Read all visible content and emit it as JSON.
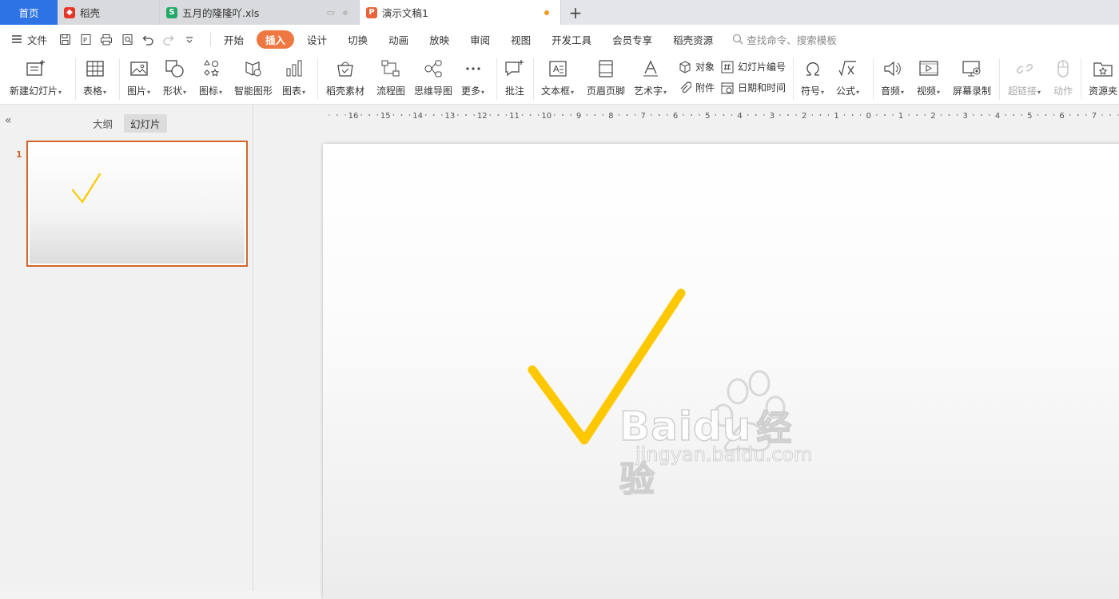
{
  "tabs": {
    "home": "首页",
    "tab1": "稻壳",
    "tab2": "五月的隆隆吖.xls",
    "tab3": "演示文稿1",
    "add": "+"
  },
  "menu": {
    "file": "文件",
    "items": [
      "开始",
      "插入",
      "设计",
      "切换",
      "动画",
      "放映",
      "审阅",
      "视图",
      "开发工具",
      "会员专享",
      "稻壳资源"
    ],
    "active_index": 1,
    "search_placeholder": "查找命令、搜索模板"
  },
  "ribbon": {
    "new_slide": "新建幻灯片",
    "table": "表格",
    "picture": "图片",
    "shape": "形状",
    "icon": "图标",
    "smart_graphic": "智能图形",
    "chart": "图表",
    "docer_material": "稻壳素材",
    "flowchart": "流程图",
    "mindmap": "思维导图",
    "more": "更多",
    "comment": "批注",
    "textbox": "文本框",
    "header_footer": "页眉页脚",
    "wordart": "艺术字",
    "object": "对象",
    "attachment": "附件",
    "slide_number": "幻灯片编号",
    "date_time": "日期和时间",
    "symbol": "符号",
    "formula": "公式",
    "audio": "音频",
    "video": "视频",
    "screen_record": "屏幕录制",
    "hyperlink": "超链接",
    "action": "动作",
    "resource": "资源夹"
  },
  "left_panel": {
    "tab_outline": "大纲",
    "tab_slides": "幻灯片",
    "slide_number": "1"
  },
  "ruler": {
    "labels": [
      "16",
      "15",
      "14",
      "13",
      "12",
      "11",
      "10",
      "9",
      "8",
      "7",
      "6",
      "5",
      "4",
      "3",
      "2",
      "1",
      "0",
      "1",
      "2",
      "3",
      "4",
      "5",
      "6",
      "7"
    ]
  },
  "watermark": {
    "brand": "Baidu",
    "brand_cn": "经验",
    "url": "jingyan.baidu.com"
  },
  "colors": {
    "accent": "#ee7742",
    "home_tab": "#2d73e6",
    "checkmark": "#fdc800",
    "selection": "#d0662a"
  }
}
